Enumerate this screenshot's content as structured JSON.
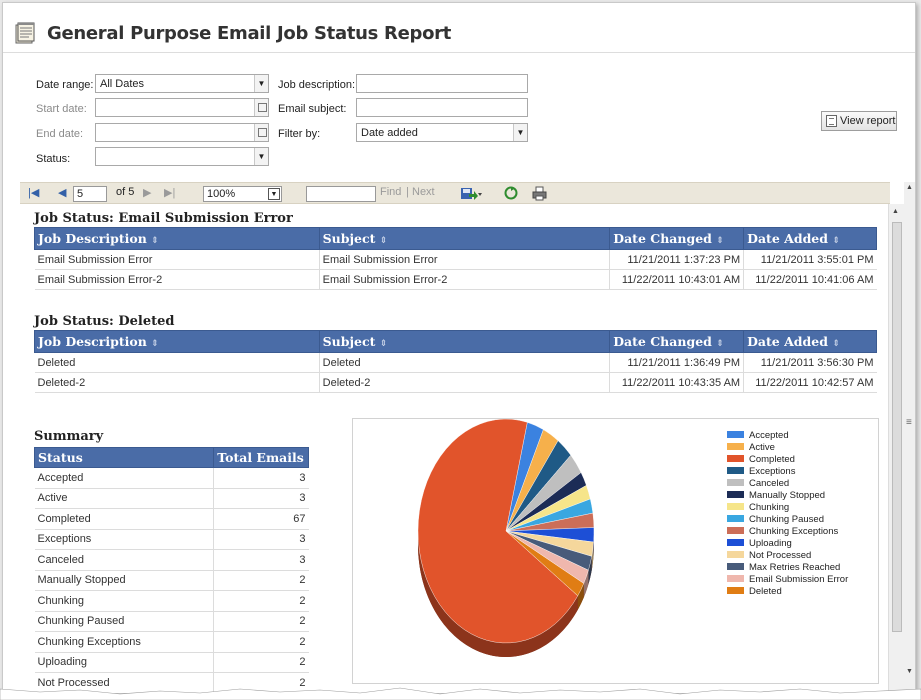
{
  "title": "General Purpose Email Job Status Report",
  "filters": {
    "date_range_label": "Date range:",
    "date_range_value": "All Dates",
    "start_date_label": "Start date:",
    "end_date_label": "End date:",
    "status_label": "Status:",
    "job_description_label": "Job description:",
    "email_subject_label": "Email subject:",
    "filter_by_label": "Filter by:",
    "filter_by_value": "Date added",
    "view_report_label": "View report"
  },
  "toolbar": {
    "page_current": "5",
    "page_of": "of 5",
    "zoom": "100%",
    "find_label": "Find",
    "separator": "|",
    "next_label": "Next"
  },
  "columns": [
    "Job Description",
    "Subject",
    "Date Changed",
    "Date Added"
  ],
  "sections": [
    {
      "title": "Job Status: Email Submission Error",
      "rows": [
        [
          "Email Submission Error",
          "Email Submission Error",
          "11/21/2011 1:37:23 PM",
          "11/21/2011 3:55:01 PM"
        ],
        [
          "Email Submission Error-2",
          "Email Submission Error-2",
          "11/22/2011 10:43:01 AM",
          "11/22/2011 10:41:06 AM"
        ]
      ]
    },
    {
      "title": "Job Status: Deleted",
      "rows": [
        [
          "Deleted",
          "Deleted",
          "11/21/2011 1:36:49 PM",
          "11/21/2011 3:56:30 PM"
        ],
        [
          "Deleted-2",
          "Deleted-2",
          "11/22/2011 10:43:35 AM",
          "11/22/2011 10:42:57 AM"
        ]
      ]
    }
  ],
  "summary": {
    "title": "Summary",
    "status_header": "Status",
    "total_header": "Total Emails",
    "rows": [
      [
        "Accepted",
        "3"
      ],
      [
        "Active",
        "3"
      ],
      [
        "Completed",
        "67"
      ],
      [
        "Exceptions",
        "3"
      ],
      [
        "Canceled",
        "3"
      ],
      [
        "Manually Stopped",
        "2"
      ],
      [
        "Chunking",
        "2"
      ],
      [
        "Chunking Paused",
        "2"
      ],
      [
        "Chunking Exceptions",
        "2"
      ],
      [
        "Uploading",
        "2"
      ],
      [
        "Not Processed",
        "2"
      ]
    ]
  },
  "chart_data": {
    "type": "pie",
    "title": "",
    "legend_position": "right",
    "labels": [
      "Accepted",
      "Active",
      "Completed",
      "Exceptions",
      "Canceled",
      "Manually Stopped",
      "Chunking",
      "Chunking Paused",
      "Chunking Exceptions",
      "Uploading",
      "Not Processed",
      "Max Retries Reached",
      "Email Submission Error",
      "Deleted"
    ],
    "values": [
      3,
      3,
      67,
      3,
      3,
      2,
      2,
      2,
      2,
      2,
      2,
      2,
      2,
      2
    ],
    "colors": [
      "#3b82e0",
      "#f6b04b",
      "#e1542b",
      "#1f5a86",
      "#bfbfbf",
      "#1c2c56",
      "#f6e58a",
      "#39a7e1",
      "#cc6e58",
      "#1d4fd6",
      "#f5d79c",
      "#485b7a",
      "#efb7ad",
      "#e07d14"
    ]
  }
}
